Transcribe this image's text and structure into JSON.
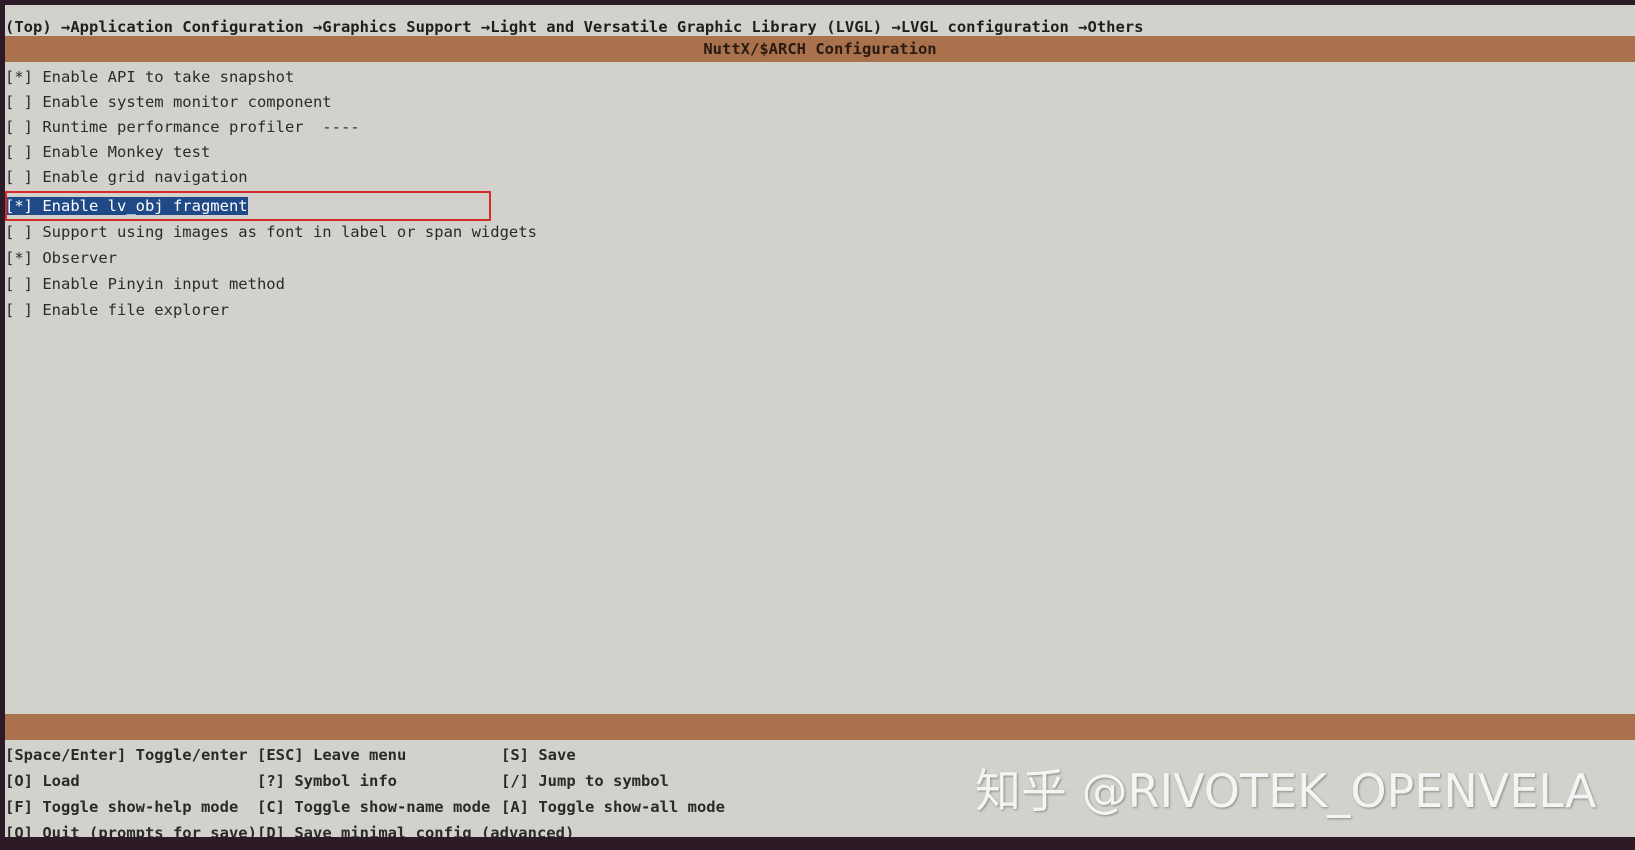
{
  "breadcrumb": "(Top) →Application Configuration →Graphics Support →Light and Versatile Graphic Library (LVGL) →LVGL configuration →Others",
  "title": "NuttX/$ARCH Configuration",
  "menu_items": [
    {
      "label": "[*] Enable API to take snapshot"
    },
    {
      "label": "[ ] Enable system monitor component"
    },
    {
      "label": "[ ] Runtime performance profiler  ----"
    },
    {
      "label": "[ ] Enable Monkey test"
    },
    {
      "label": "[ ] Enable grid navigation"
    },
    {
      "label": "[*] Enable lv_obj fragment",
      "selected": true
    },
    {
      "label": "[ ] Support using images as font in label or span widgets"
    },
    {
      "label": "[*] Observer"
    },
    {
      "label": "[ ] Enable Pinyin input method"
    },
    {
      "label": "[ ] Enable file explorer"
    }
  ],
  "help_keys": [
    [
      "[Space/Enter] Toggle/enter",
      "[ESC] Leave menu",
      "[S] Save"
    ],
    [
      "[O] Load",
      "[?] Symbol info",
      "[/] Jump to symbol"
    ],
    [
      "[F] Toggle show-help mode",
      "[C] Toggle show-name mode",
      "[A] Toggle show-all mode"
    ],
    [
      "[Q] Quit (prompts for save)",
      "[D] Save minimal config (advanced)",
      ""
    ]
  ],
  "watermark": "知乎 @RIVOTEK_OPENVELA",
  "colors": {
    "background": "#d3d1cc",
    "title_bar": "#a9724d",
    "selection": "#204a87",
    "highlight_box": "#d22b2b"
  }
}
